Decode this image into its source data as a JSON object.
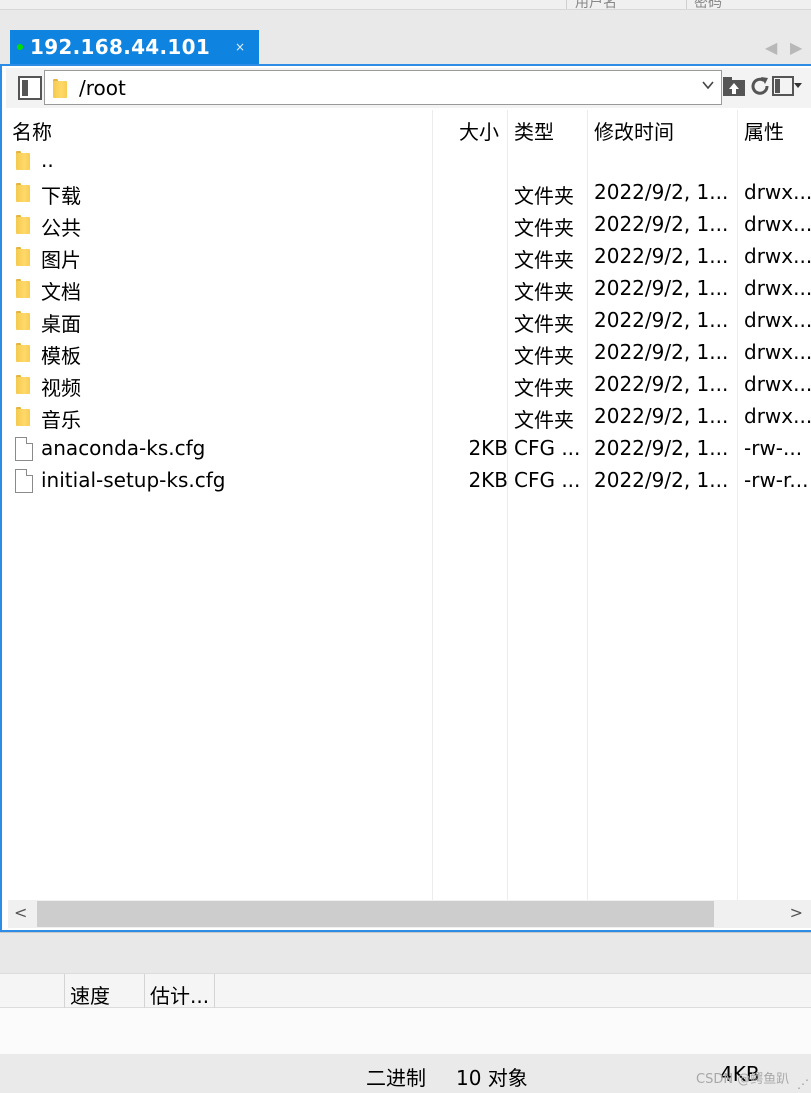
{
  "top_columns": [
    "用户名",
    "密码"
  ],
  "tab": {
    "title": "192.168.44.101",
    "close": "×"
  },
  "nav": {
    "prev": "◀",
    "next": "▶"
  },
  "path": {
    "value": "/root",
    "dropdown_icon": "chevron-down-icon"
  },
  "columns": {
    "name": "名称",
    "size": "大小",
    "type": "类型",
    "modified": "修改时间",
    "attrs": "属性"
  },
  "rows": [
    {
      "icon": "folder-icon",
      "name": "..",
      "size": "",
      "type": "",
      "modified": "",
      "attrs": ""
    },
    {
      "icon": "folder-icon",
      "name": "下载",
      "size": "",
      "type": "文件夹",
      "modified": "2022/9/2, 1...",
      "attrs": "drwx..."
    },
    {
      "icon": "folder-icon",
      "name": "公共",
      "size": "",
      "type": "文件夹",
      "modified": "2022/9/2, 1...",
      "attrs": "drwx..."
    },
    {
      "icon": "folder-icon",
      "name": "图片",
      "size": "",
      "type": "文件夹",
      "modified": "2022/9/2, 1...",
      "attrs": "drwx..."
    },
    {
      "icon": "folder-icon",
      "name": "文档",
      "size": "",
      "type": "文件夹",
      "modified": "2022/9/2, 1...",
      "attrs": "drwx..."
    },
    {
      "icon": "folder-icon",
      "name": "桌面",
      "size": "",
      "type": "文件夹",
      "modified": "2022/9/2, 1...",
      "attrs": "drwx..."
    },
    {
      "icon": "folder-icon",
      "name": "模板",
      "size": "",
      "type": "文件夹",
      "modified": "2022/9/2, 1...",
      "attrs": "drwx..."
    },
    {
      "icon": "folder-icon",
      "name": "视频",
      "size": "",
      "type": "文件夹",
      "modified": "2022/9/2, 1...",
      "attrs": "drwx..."
    },
    {
      "icon": "folder-icon",
      "name": "音乐",
      "size": "",
      "type": "文件夹",
      "modified": "2022/9/2, 1...",
      "attrs": "drwx..."
    },
    {
      "icon": "file-icon",
      "name": "anaconda-ks.cfg",
      "size": "2KB",
      "type": "CFG ...",
      "modified": "2022/9/2, 1...",
      "attrs": "-rw-..."
    },
    {
      "icon": "file-icon",
      "name": "initial-setup-ks.cfg",
      "size": "2KB",
      "type": "CFG ...",
      "modified": "2022/9/2, 1...",
      "attrs": "-rw-r..."
    }
  ],
  "scrollbar": {
    "left": "<",
    "right": ">"
  },
  "queue_columns": [
    "速度",
    "估计..."
  ],
  "status": {
    "mode": "二进制",
    "objects": "10 对象",
    "total": "4KB"
  },
  "watermark": "CSDN @鳄鱼趴",
  "colors": {
    "accent": "#0e83e0",
    "frame": "#2d8ce6",
    "online_dot": "#00e000",
    "folder": "#f4c94e"
  }
}
